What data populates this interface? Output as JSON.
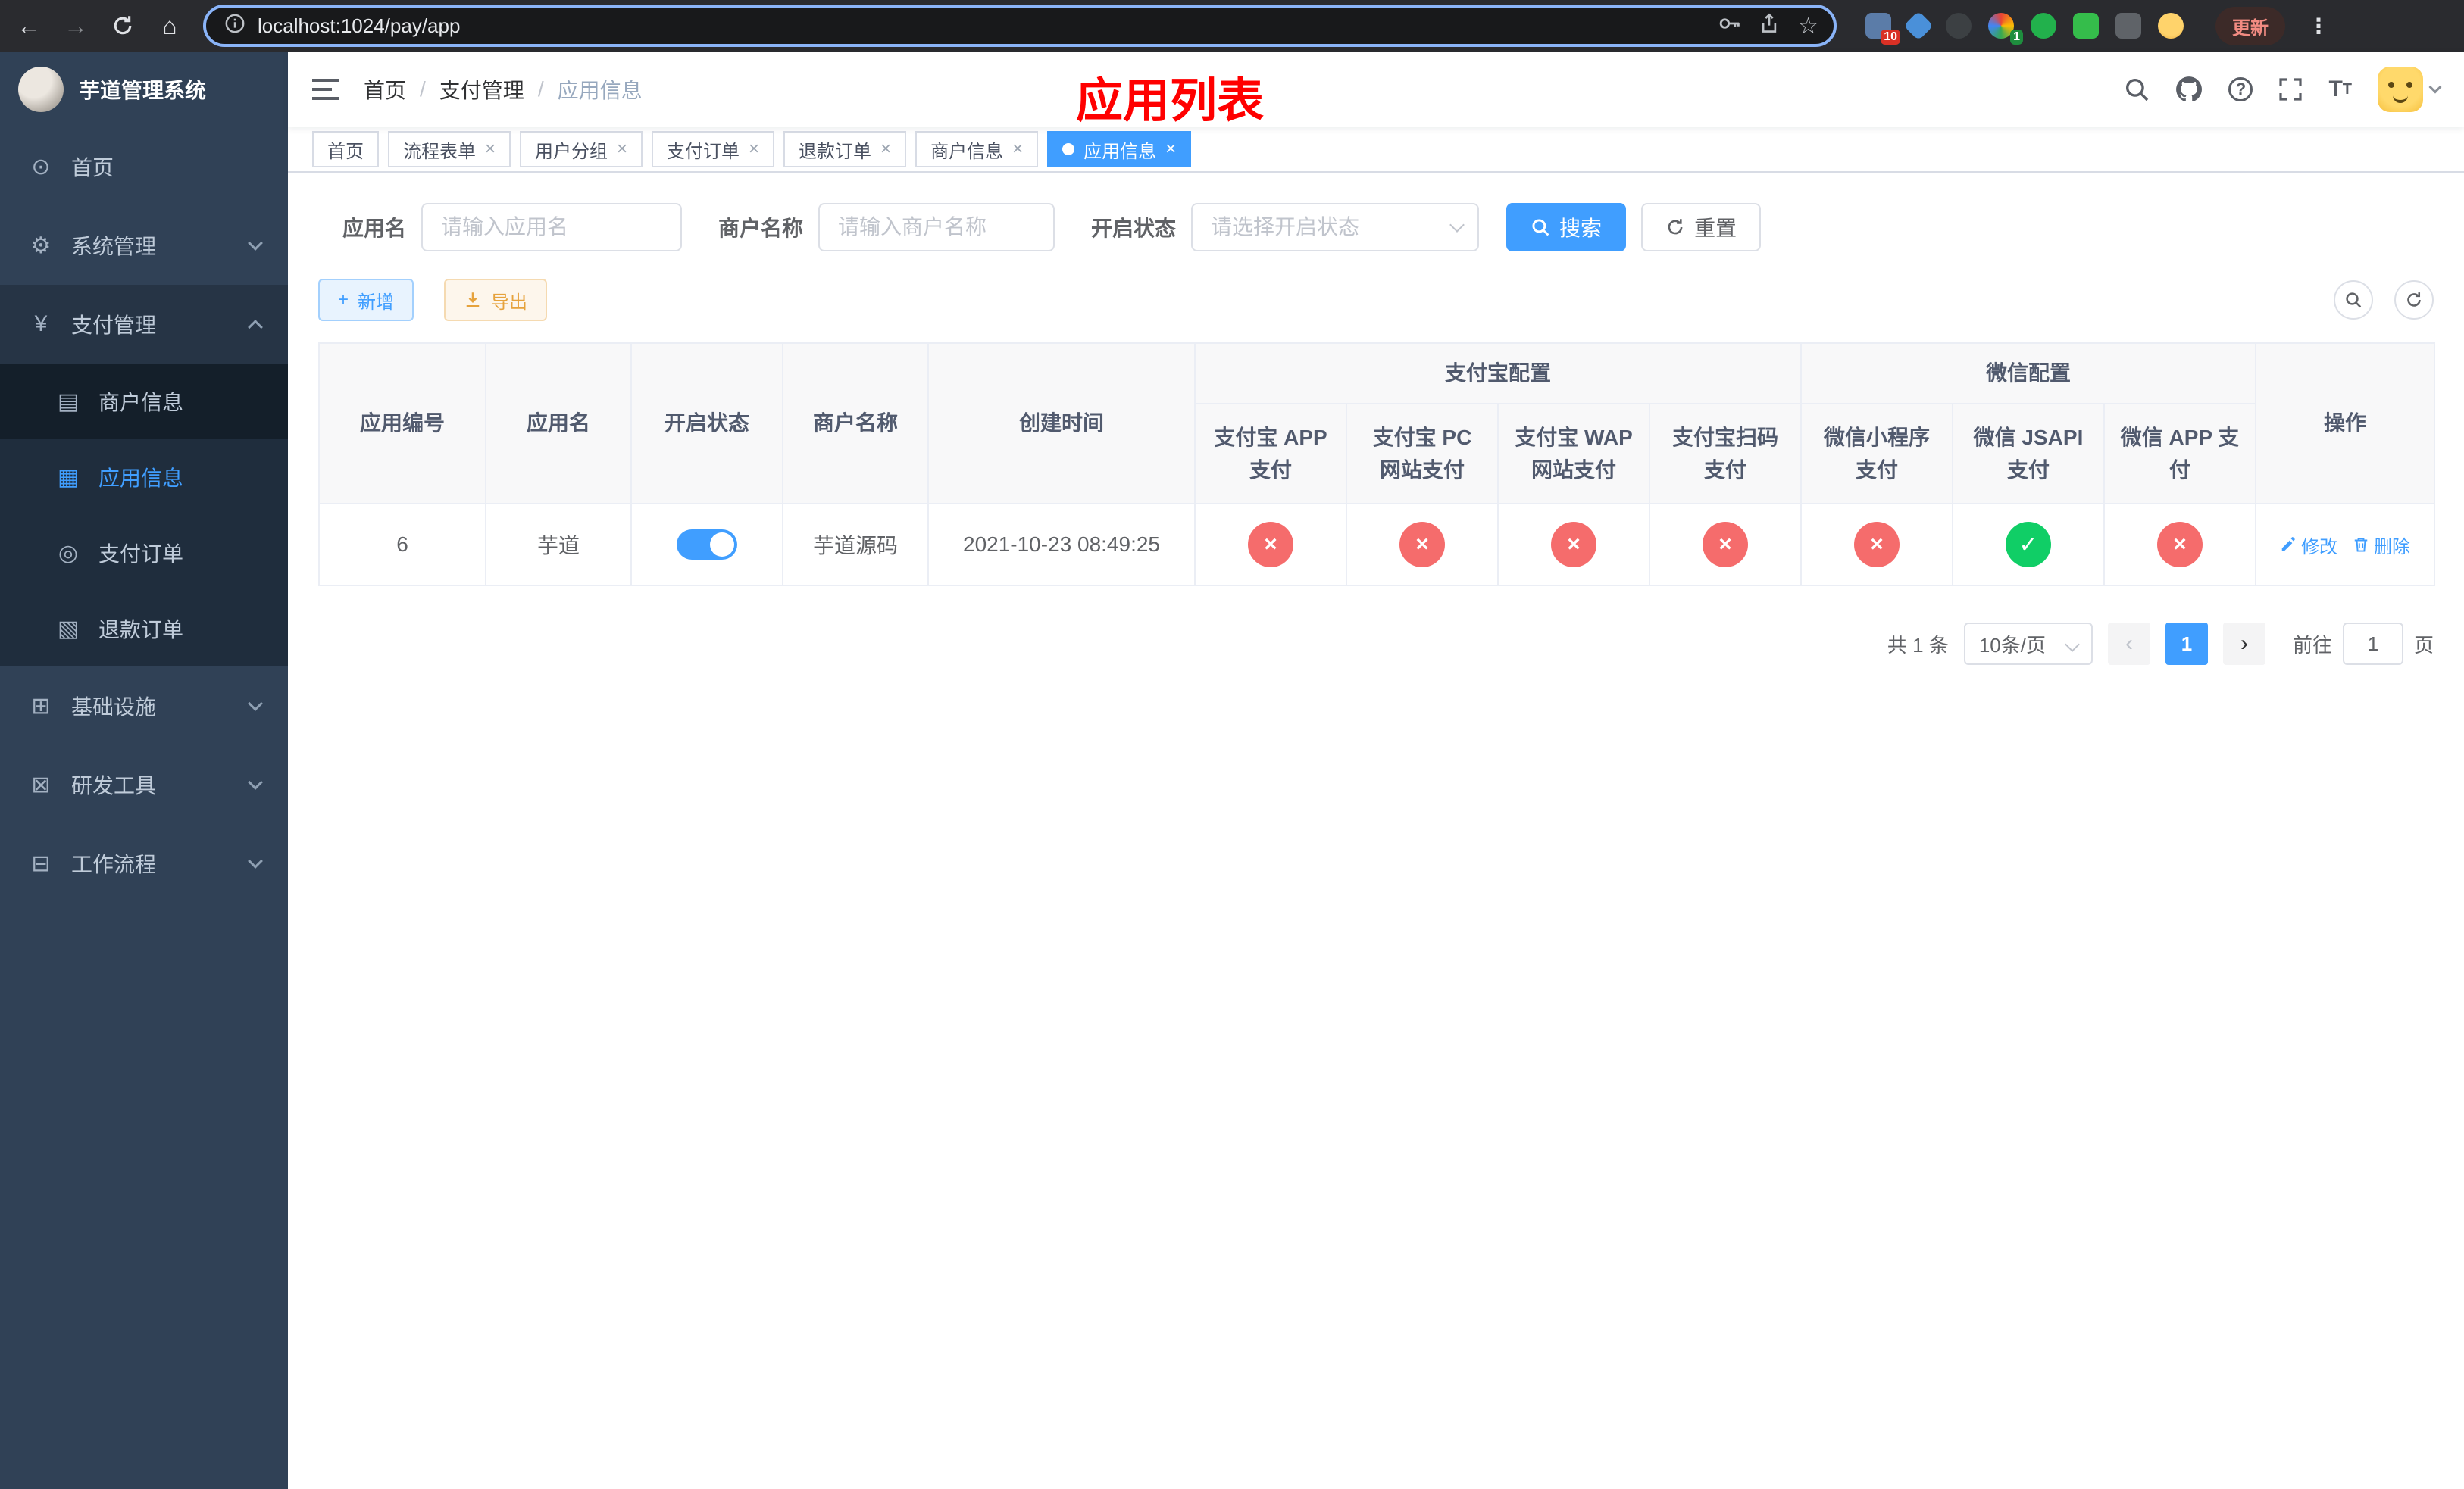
{
  "browser": {
    "url": "localhost:1024/pay/app",
    "update_label": "更新",
    "extension_badge_1": "10",
    "extension_badge_2": "1"
  },
  "sidebar": {
    "logo_title": "芋道管理系统",
    "menu": {
      "home": "首页",
      "system": "系统管理",
      "payment": "支付管理",
      "infra": "基础设施",
      "devtools": "研发工具",
      "workflow": "工作流程"
    },
    "payment_children": {
      "merchant": "商户信息",
      "app": "应用信息",
      "order": "支付订单",
      "refund": "退款订单"
    }
  },
  "navbar": {
    "breadcrumb": {
      "home": "首页",
      "section": "支付管理",
      "current": "应用信息"
    },
    "overlay_title": "应用列表"
  },
  "tabs": {
    "items": [
      {
        "label": "首页"
      },
      {
        "label": "流程表单"
      },
      {
        "label": "用户分组"
      },
      {
        "label": "支付订单"
      },
      {
        "label": "退款订单"
      },
      {
        "label": "商户信息"
      },
      {
        "label": "应用信息"
      }
    ]
  },
  "filters": {
    "app_name": {
      "label": "应用名",
      "placeholder": "请输入应用名"
    },
    "merchant_name": {
      "label": "商户名称",
      "placeholder": "请输入商户名称"
    },
    "status": {
      "label": "开启状态",
      "placeholder": "请选择开启状态"
    },
    "search_label": "搜索",
    "reset_label": "重置"
  },
  "toolbar": {
    "add_label": "新增",
    "export_label": "导出"
  },
  "table": {
    "headers": {
      "app_id": "应用编号",
      "app_name": "应用名",
      "status": "开启状态",
      "merchant_name": "商户名称",
      "create_time": "创建时间",
      "alipay_group": "支付宝配置",
      "alipay_app": "支付宝 APP 支付",
      "alipay_pc": "支付宝 PC 网站支付",
      "alipay_wap": "支付宝 WAP 网站支付",
      "alipay_scan": "支付宝扫码支付",
      "wechat_group": "微信配置",
      "wechat_mini": "微信小程序支付",
      "wechat_jsapi": "微信 JSAPI 支付",
      "wechat_app": "微信 APP 支付",
      "actions": "操作"
    },
    "rows": [
      {
        "app_id": "6",
        "app_name": "芋道",
        "status_enabled": true,
        "merchant_name": "芋道源码",
        "create_time": "2021-10-23 08:49:25",
        "alipay_app": false,
        "alipay_pc": false,
        "alipay_wap": false,
        "alipay_scan": false,
        "wechat_mini": false,
        "wechat_jsapi": true,
        "wechat_app": false,
        "edit_label": "修改",
        "delete_label": "删除"
      }
    ]
  },
  "pagination": {
    "total_text": "共 1 条",
    "page_size": "10条/页",
    "current_page": "1",
    "goto_label": "前往",
    "goto_value": "1",
    "goto_suffix": "页"
  }
}
